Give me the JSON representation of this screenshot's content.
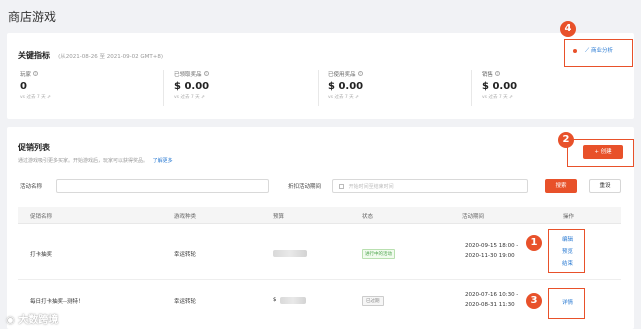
{
  "page": {
    "title": "商店游戏"
  },
  "metrics": {
    "title": "关键指标",
    "date_range": "(从2021-08-26 至 2021-09-02 GMT+8)",
    "items": [
      {
        "label": "玩家",
        "value": "0",
        "compare": "vs 过去 7 天"
      },
      {
        "label": "已领取奖品",
        "value": "$ 0.00",
        "compare": "vs 过去 7 天"
      },
      {
        "label": "已使用奖品",
        "value": "$ 0.00",
        "compare": "vs 过去 7 天"
      },
      {
        "label": "销售",
        "value": "$ 0.00",
        "compare": "vs 过去 7 天"
      }
    ],
    "business_analysis_label": "商业分析"
  },
  "promo": {
    "title": "促销列表",
    "desc": "通过游戏吸引更多买家。开始游戏后，玩家可以获得奖品。",
    "learn_more": "了解更多",
    "create_label": "+ 创建",
    "filters": {
      "name_label": "活动名称",
      "name_placeholder": "",
      "date_label": "折扣活动期间",
      "date_placeholder": "开始时间至结束时间",
      "search_label": "搜索",
      "reset_label": "重设"
    },
    "columns": [
      "促销名称",
      "游戏种类",
      "预算",
      "状态",
      "活动期间",
      "操作"
    ],
    "rows": [
      {
        "name": "打卡抽奖",
        "game_type": "幸运转轮",
        "budget_prefix": "",
        "status": "进行中的活动",
        "period_start": "2020-09-15 18:00 -",
        "period_end": "2020-11-30 19:00",
        "actions": [
          "编辑",
          "预览",
          "结束"
        ]
      },
      {
        "name": "每日打卡抽奖--测特！",
        "game_type": "幸运转轮",
        "budget_prefix": "$",
        "status": "已过期",
        "period_start": "2020-07-16 10:30 -",
        "period_end": "2020-08-31 11:30",
        "actions": [
          "详情"
        ]
      }
    ]
  },
  "annotations": {
    "badges": [
      "1",
      "2",
      "3",
      "4"
    ]
  },
  "watermark": "大数跨境",
  "colors": {
    "accent": "#e8512a",
    "link": "#2b7bd3",
    "background": "#f1f2f5"
  }
}
